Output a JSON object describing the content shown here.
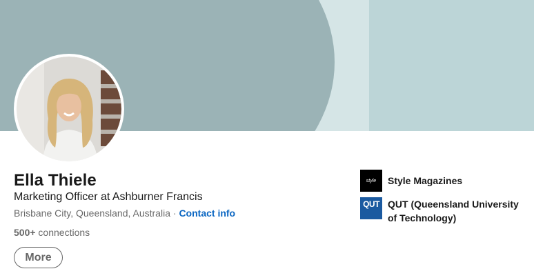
{
  "profile": {
    "name": "Ella Thiele",
    "headline": "Marketing Officer at Ashburner Francis",
    "location": "Brisbane City, Queensland, Australia",
    "separator": " · ",
    "contact_info": "Contact info",
    "connections_count": "500+",
    "connections_label": " connections",
    "more_button": "More"
  },
  "organizations": [
    {
      "name": "Style Magazines",
      "logo_text": "style",
      "logo_bg": "#000000"
    },
    {
      "name": "QUT (Queensland University of Technology)",
      "logo_text": "QUT",
      "logo_bg": "#1b5aa0"
    }
  ],
  "colors": {
    "banner_dark": "#9bb3b6",
    "banner_light": "#bcd5d7",
    "link": "#0a66c2"
  }
}
